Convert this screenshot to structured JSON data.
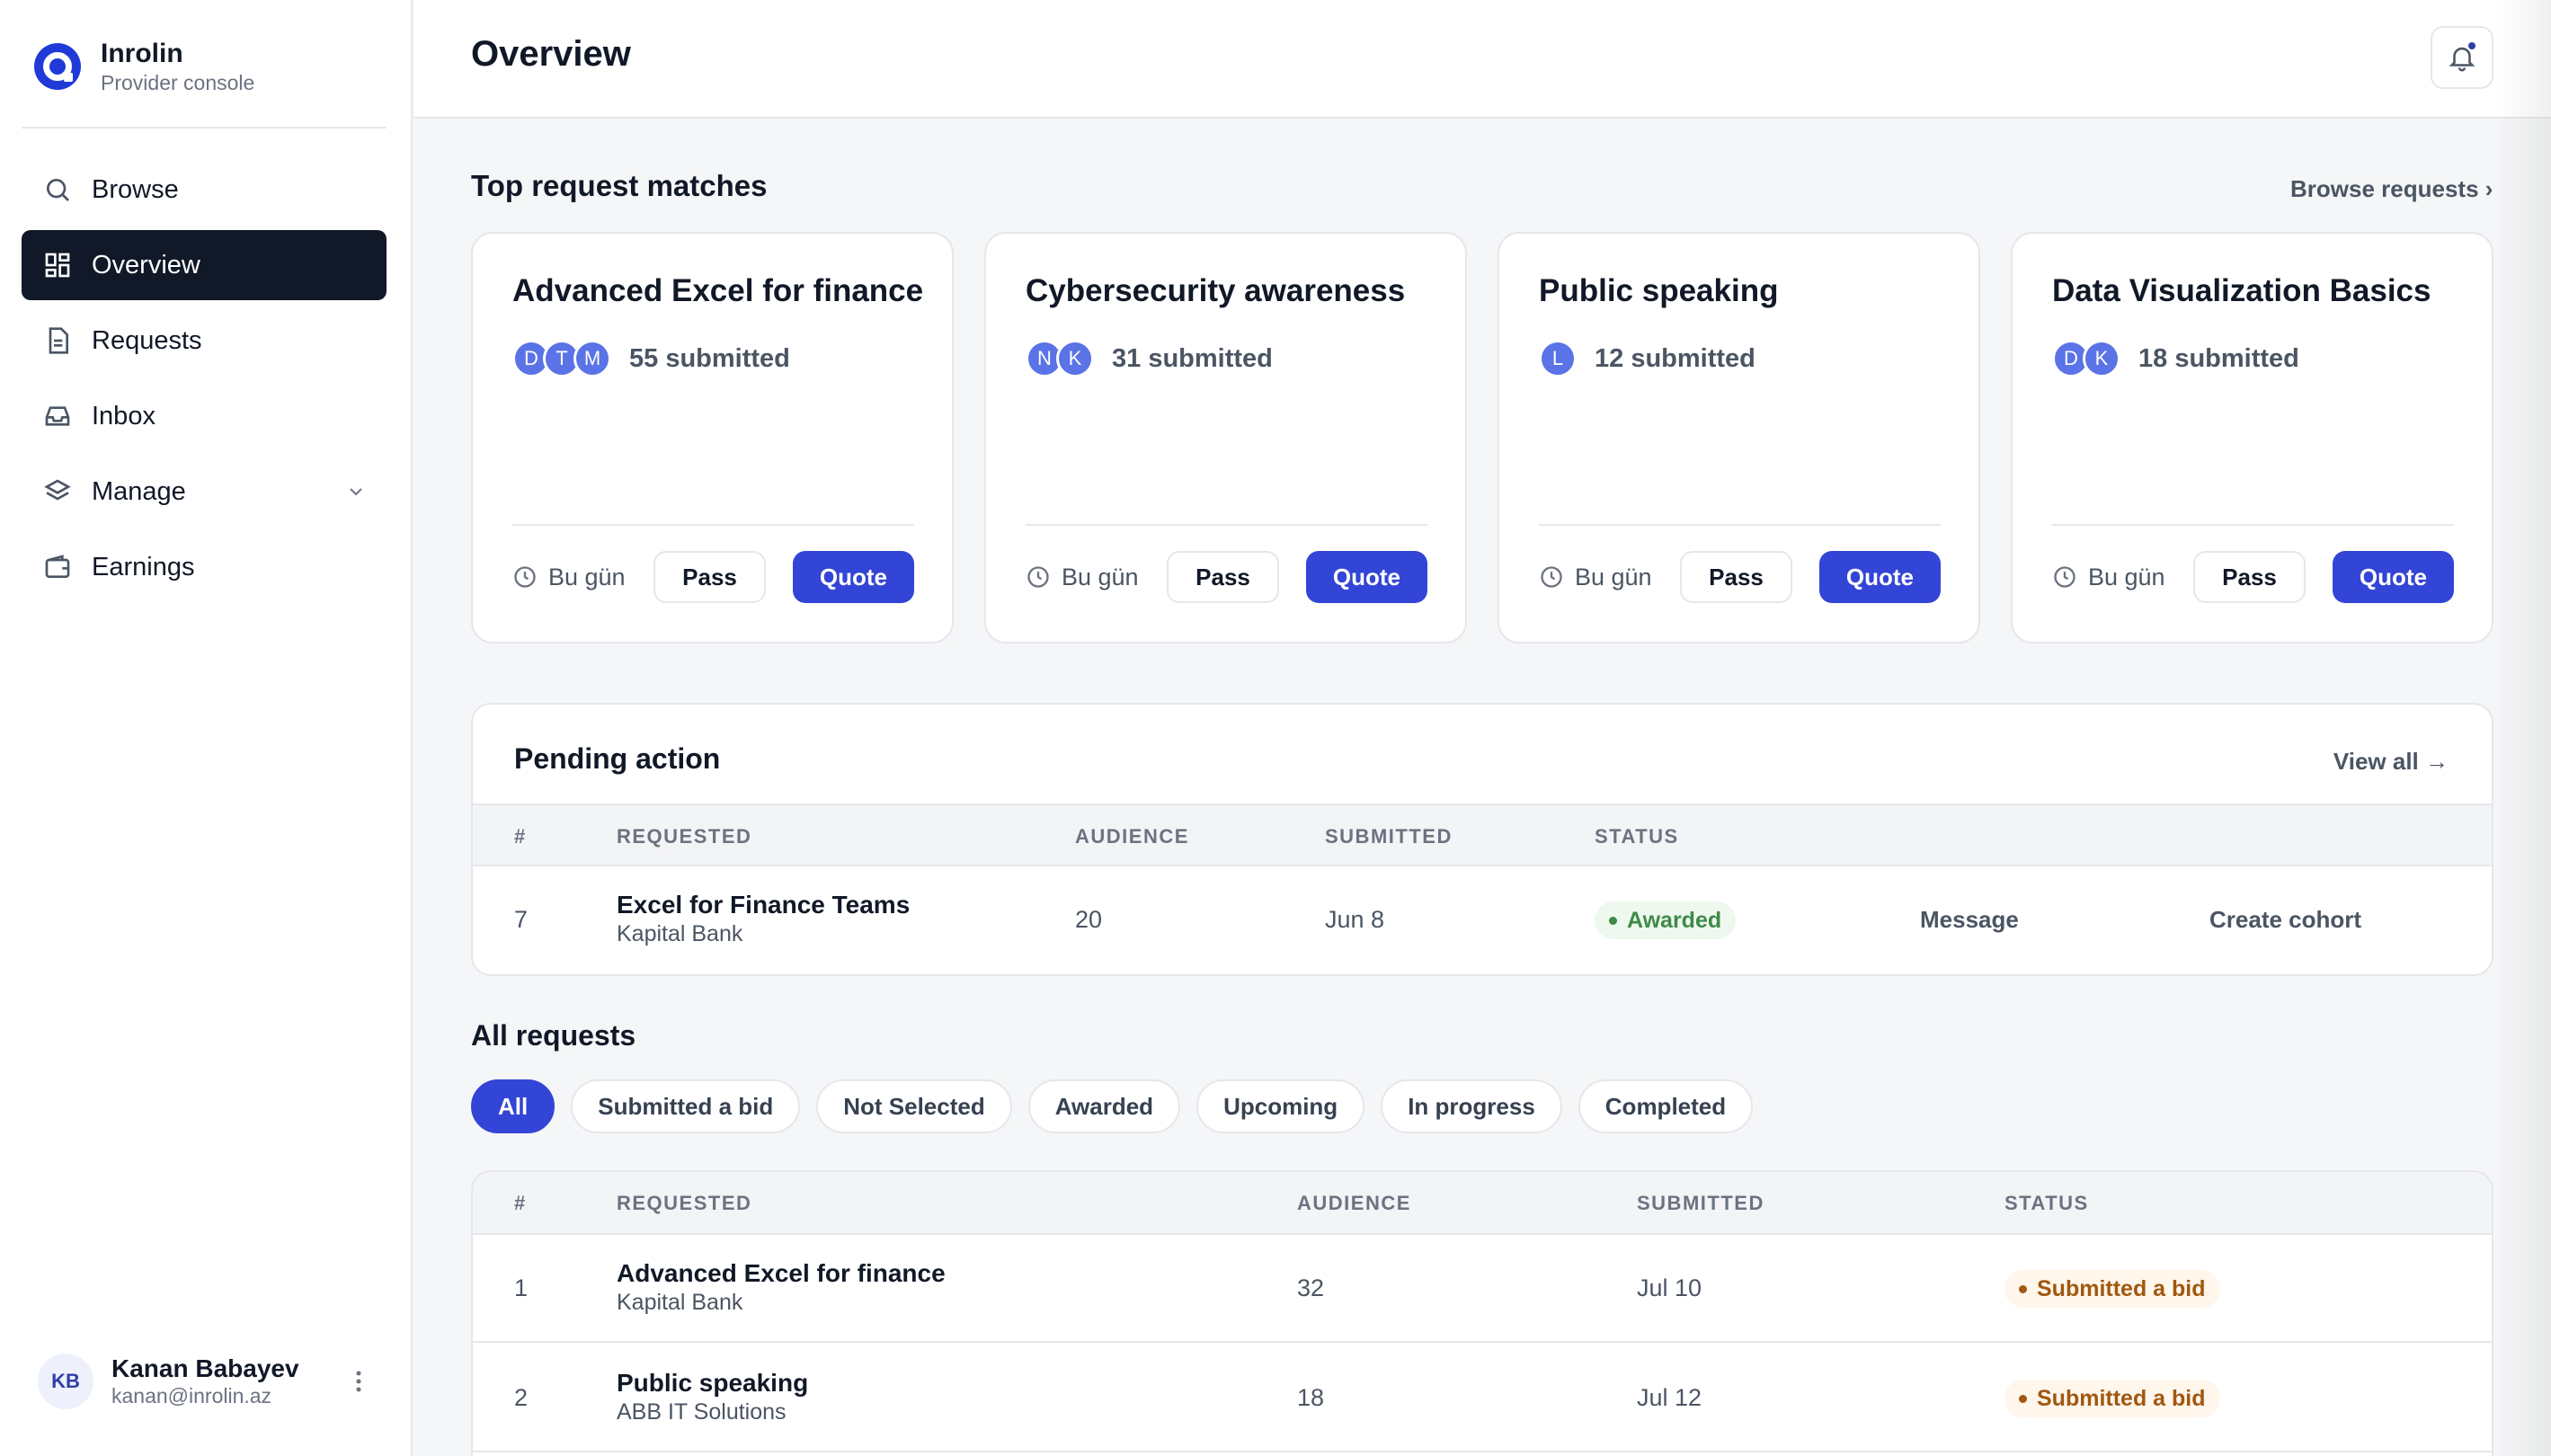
{
  "brand": {
    "name": "Inrolin",
    "subtitle": "Provider console"
  },
  "nav": {
    "browse": "Browse",
    "overview": "Overview",
    "requests": "Requests",
    "inbox": "Inbox",
    "manage": "Manage",
    "earnings": "Earnings"
  },
  "user": {
    "initials": "KB",
    "name": "Kanan Babayev",
    "email": "kanan@inrolin.az"
  },
  "header": {
    "title": "Overview"
  },
  "matches": {
    "title": "Top request matches",
    "browse_link": "Browse requests ›",
    "cards": [
      {
        "title": "Advanced Excel for finance",
        "avatars": [
          "D",
          "T",
          "M"
        ],
        "submitted": "55 submitted",
        "time": "Bu gün",
        "pass": "Pass",
        "quote": "Quote"
      },
      {
        "title": "Cybersecurity awareness",
        "avatars": [
          "N",
          "K"
        ],
        "submitted": "31 submitted",
        "time": "Bu gün",
        "pass": "Pass",
        "quote": "Quote"
      },
      {
        "title": "Public speaking",
        "avatars": [
          "L"
        ],
        "submitted": "12 submitted",
        "time": "Bu gün",
        "pass": "Pass",
        "quote": "Quote"
      },
      {
        "title": "Data Visualization Basics",
        "avatars": [
          "D",
          "K"
        ],
        "submitted": "18 submitted",
        "time": "Bu gün",
        "pass": "Pass",
        "quote": "Quote"
      }
    ]
  },
  "pending": {
    "title": "Pending action",
    "view_all": "View all →",
    "columns": [
      "#",
      "REQUESTED",
      "AUDIENCE",
      "SUBMITTED",
      "STATUS"
    ],
    "rows": [
      {
        "num": "7",
        "title": "Excel for Finance Teams",
        "org": "Kapital Bank",
        "audience": "20",
        "submitted": "Jun 8",
        "status": "Awarded",
        "message": "Message",
        "create": "Create cohort"
      }
    ]
  },
  "all": {
    "title": "All requests",
    "filters": [
      "All",
      "Submitted a bid",
      "Not Selected",
      "Awarded",
      "Upcoming",
      "In progress",
      "Completed"
    ],
    "columns": [
      "#",
      "REQUESTED",
      "AUDIENCE",
      "SUBMITTED",
      "STATUS"
    ],
    "rows": [
      {
        "num": "1",
        "title": "Advanced Excel for finance",
        "org": "Kapital Bank",
        "audience": "32",
        "submitted": "Jul 10",
        "status": "Submitted a bid"
      },
      {
        "num": "2",
        "title": "Public speaking",
        "org": "ABB IT Solutions",
        "audience": "18",
        "submitted": "Jul 12",
        "status": "Submitted a bid"
      }
    ]
  },
  "colors": {
    "accent": "#3345d6",
    "sidebar_active": "#111827",
    "awarded": "#3f8a47",
    "bid": "#a0580f"
  }
}
